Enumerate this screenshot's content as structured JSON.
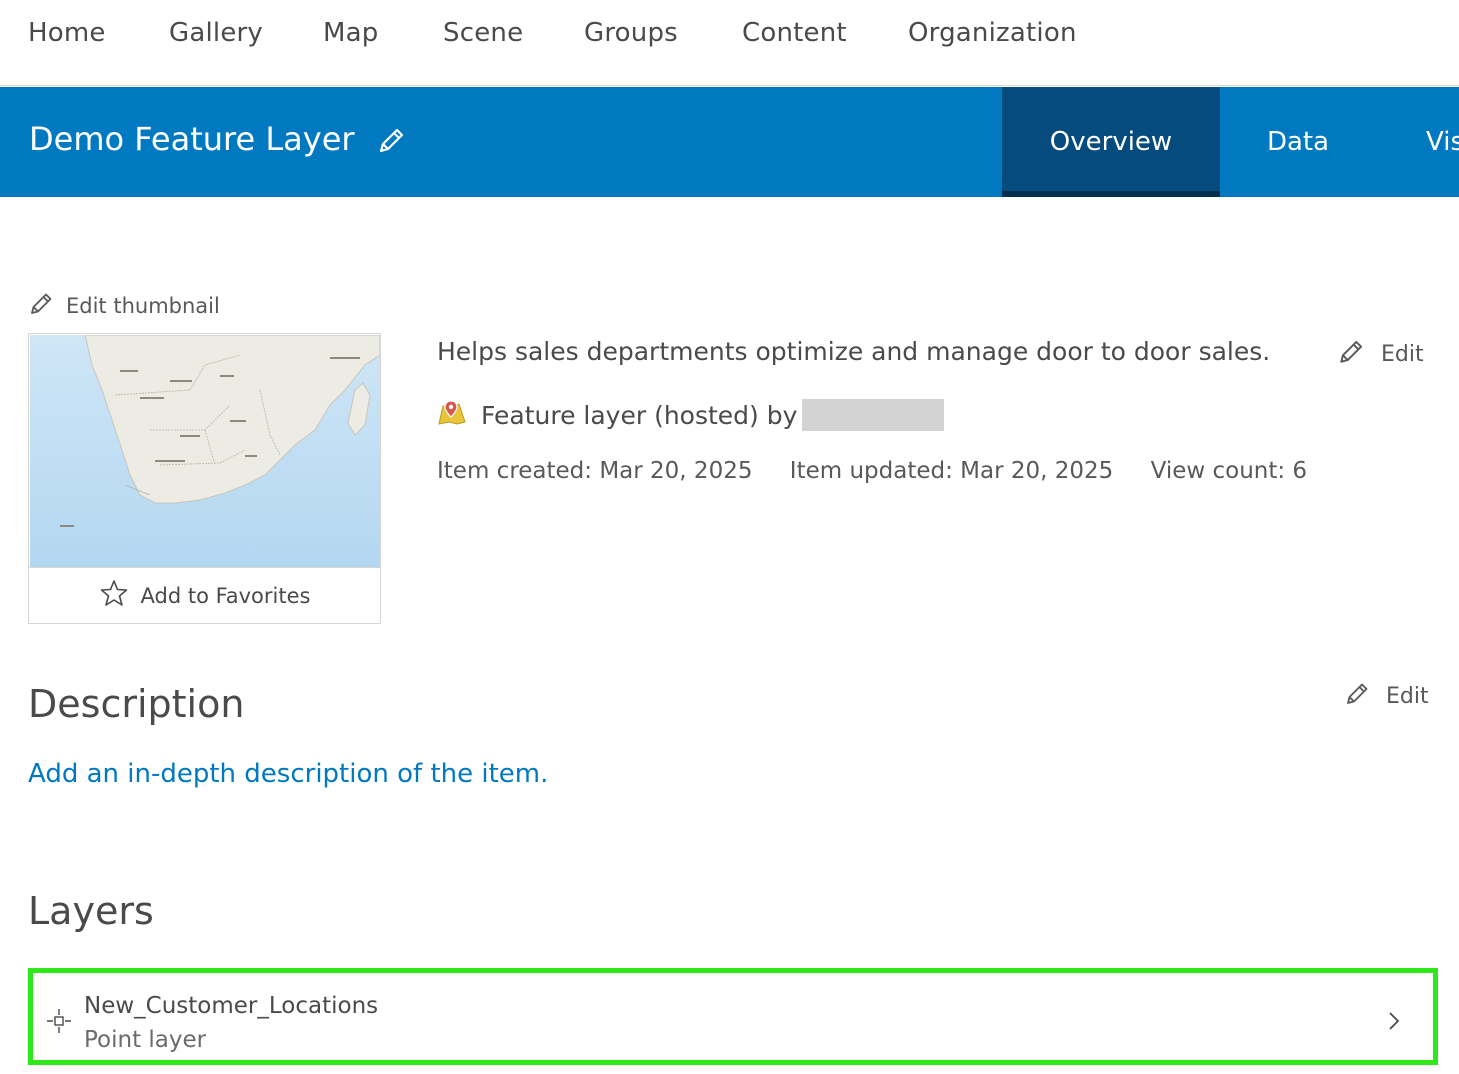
{
  "topnav": {
    "items": [
      "Home",
      "Gallery",
      "Map",
      "Scene",
      "Groups",
      "Content",
      "Organization"
    ]
  },
  "header": {
    "title": "Demo Feature Layer",
    "tabs": [
      "Overview",
      "Data",
      "Vis"
    ],
    "active_tab": "Overview",
    "bg_color": "#0079c1",
    "active_tab_color": "#054b7d"
  },
  "thumbnail": {
    "edit_label": "Edit thumbnail",
    "favorite_label": "Add to Favorites"
  },
  "summary": {
    "text": "Helps sales departments optimize and manage door to door sales.",
    "edit_label": "Edit",
    "type_text": "Feature layer (hosted) by",
    "owner_redacted": true,
    "created": "Item created: Mar 20, 2025",
    "updated": "Item updated: Mar 20, 2025",
    "views": "View count: 6"
  },
  "description": {
    "title": "Description",
    "edit_label": "Edit",
    "placeholder_link": "Add an in-depth description of the item."
  },
  "layers": {
    "title": "Layers",
    "items": [
      {
        "name": "New_Customer_Locations",
        "type": "Point layer",
        "highlighted": true
      }
    ],
    "highlight_color": "#2ee81a"
  },
  "icons": [
    "pencil-icon",
    "star-icon",
    "feature-layer-icon",
    "point-layer-icon",
    "chevron-right-icon"
  ]
}
